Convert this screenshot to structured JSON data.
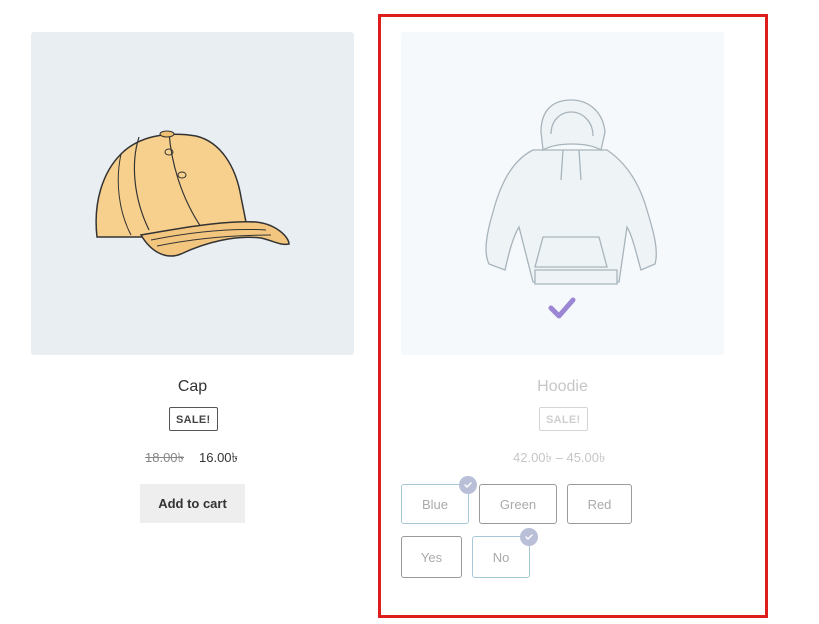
{
  "products": {
    "cap": {
      "title": "Cap",
      "sale_badge": "SALE!",
      "old_price": "18.00৳",
      "new_price": "16.00৳",
      "add_to_cart_label": "Add to cart",
      "image_icon": "cap-illustration-icon"
    },
    "hoodie": {
      "title": "Hoodie",
      "sale_badge": "SALE!",
      "price_range": "42.00৳ – 45.00৳",
      "image_icon": "hoodie-illustration-icon",
      "selected_overlay_icon": "checkmark-icon",
      "colors": [
        {
          "label": "Blue",
          "selected": true
        },
        {
          "label": "Green",
          "selected": false
        },
        {
          "label": "Red",
          "selected": false
        }
      ],
      "logo_options": [
        {
          "label": "Yes",
          "selected": false
        },
        {
          "label": "No",
          "selected": true
        }
      ]
    }
  },
  "colors": {
    "highlight_frame": "#dd1c1c",
    "cap_fill": "#f7d08d",
    "check_purple": "#9b87d4",
    "badge_bg": "#b8bfd7",
    "selected_border": "#a7c8d6"
  }
}
